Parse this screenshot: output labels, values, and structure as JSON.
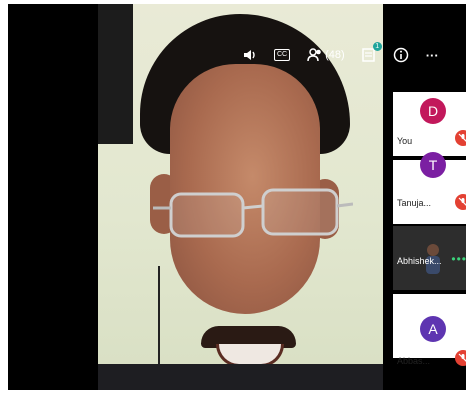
{
  "toolbar": {
    "volume_icon": "volume-icon",
    "captions_label": "CC",
    "participants_count": "(48)",
    "chat_badge": "1",
    "info_icon": "info-icon",
    "more_label": "···"
  },
  "participants": [
    {
      "initial": "D",
      "name": "You",
      "avatar_color": "#c2185b",
      "muted": true
    },
    {
      "initial": "T",
      "name": "Tanuja...",
      "avatar_color": "#7b1fa2",
      "muted": true
    },
    {
      "initial": "",
      "name": "Abhishek...",
      "avatar_color": "",
      "muted": false,
      "has_video": true
    },
    {
      "initial": "A",
      "name": "Abbas...",
      "avatar_color": "#5e35b1",
      "muted": true
    }
  ],
  "colors": {
    "mute_red": "#e34133",
    "speaking_green": "#3bd27a",
    "badge_teal": "#1fa59b"
  }
}
